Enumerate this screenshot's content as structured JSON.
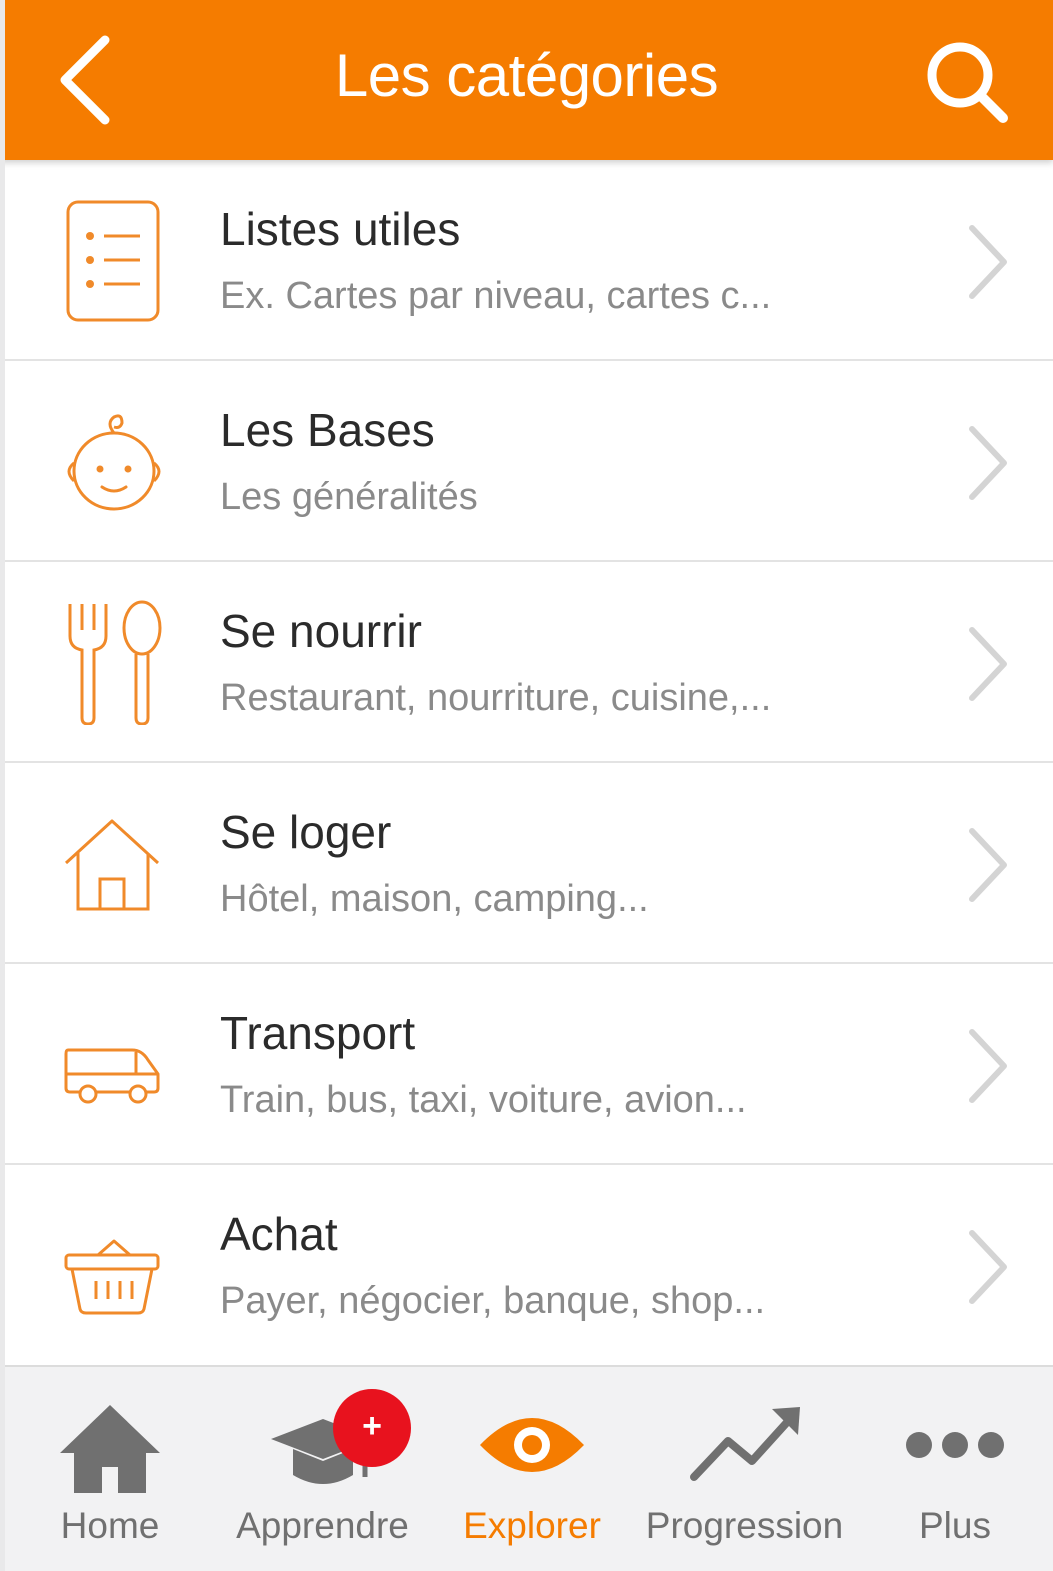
{
  "header": {
    "title": "Les catégories",
    "back_icon": "chevron-left-icon",
    "search_icon": "search-icon"
  },
  "colors": {
    "accent": "#f57c00",
    "text_primary": "#2b2b2b",
    "text_secondary": "#8a8a8a",
    "tab_inactive": "#707070",
    "badge": "#e8121e"
  },
  "categories": [
    {
      "title": "Listes utiles",
      "subtitle": "Ex. Cartes par niveau, cartes c...",
      "icon": "checklist-icon"
    },
    {
      "title": "Les Bases",
      "subtitle": "Les généralités",
      "icon": "baby-face-icon"
    },
    {
      "title": "Se nourrir",
      "subtitle": "Restaurant, nourriture, cuisine,...",
      "icon": "fork-spoon-icon"
    },
    {
      "title": "Se loger",
      "subtitle": "Hôtel, maison, camping...",
      "icon": "house-icon"
    },
    {
      "title": "Transport",
      "subtitle": "Train, bus, taxi, voiture, avion...",
      "icon": "van-icon"
    },
    {
      "title": "Achat",
      "subtitle": "Payer, négocier, banque, shop...",
      "icon": "basket-icon"
    }
  ],
  "tabs": [
    {
      "label": "Home",
      "icon": "home-icon",
      "active": false
    },
    {
      "label": "Apprendre",
      "icon": "graduation-cap-icon",
      "active": false,
      "badge": "+"
    },
    {
      "label": "Explorer",
      "icon": "eye-icon",
      "active": true
    },
    {
      "label": "Progression",
      "icon": "trending-up-icon",
      "active": false
    },
    {
      "label": "Plus",
      "icon": "more-dots-icon",
      "active": false
    }
  ]
}
